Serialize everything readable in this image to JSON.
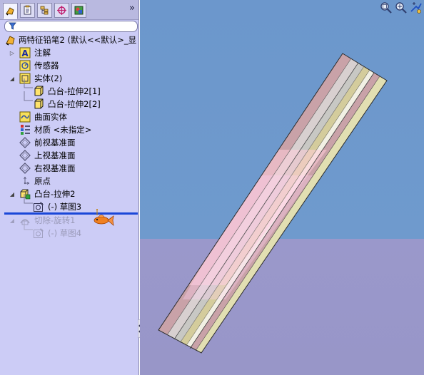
{
  "feature_manager": {
    "tabs": [
      {
        "name": "featuremanager-tab",
        "active": true
      },
      {
        "name": "propertymanager-tab",
        "active": false
      },
      {
        "name": "configurationmanager-tab",
        "active": false
      },
      {
        "name": "dimxpertmanager-tab",
        "active": false
      },
      {
        "name": "displaymanager-tab",
        "active": false
      }
    ],
    "overflow_label": "»",
    "filter_placeholder": "",
    "root_label": "两特征铅笔2 (默认<<默认>_显",
    "items": [
      {
        "label": "注解",
        "icon": "annotation-icon",
        "expander": "plus"
      },
      {
        "label": "传感器",
        "icon": "sensor-icon",
        "expander": ""
      },
      {
        "label": "实体(2)",
        "icon": "solid-bodies-folder-icon",
        "expander": "minus"
      },
      {
        "label": "凸台-拉伸2[1]",
        "icon": "solid-body-icon",
        "expander": ""
      },
      {
        "label": "凸台-拉伸2[2]",
        "icon": "solid-body-icon",
        "expander": ""
      },
      {
        "label": "曲面实体",
        "icon": "surface-bodies-folder-icon",
        "expander": ""
      },
      {
        "label": "材质 <未指定>",
        "icon": "material-icon",
        "expander": ""
      },
      {
        "label": "前视基准面",
        "icon": "plane-icon",
        "expander": ""
      },
      {
        "label": "上视基准面",
        "icon": "plane-icon",
        "expander": ""
      },
      {
        "label": "右视基准面",
        "icon": "plane-icon",
        "expander": ""
      },
      {
        "label": "原点",
        "icon": "origin-icon",
        "expander": ""
      },
      {
        "label": "凸台-拉伸2",
        "icon": "extrude-icon",
        "expander": "minus"
      },
      {
        "label": "(-) 草图3",
        "icon": "sketch-icon",
        "expander": ""
      },
      {
        "label": "切除-旋转1",
        "icon": "cut-revolve-icon",
        "expander": "minus",
        "suppressed": true
      },
      {
        "label": "(-) 草图4",
        "icon": "sketch-icon",
        "expander": "",
        "suppressed": true
      }
    ]
  },
  "graphics_area": {
    "toolbar": [
      "zoom-to-fit-icon",
      "zoom-to-area-icon",
      "previous-view-icon"
    ],
    "colors": {
      "sky": "#6f9acd",
      "ground": "#9a98cb",
      "pencil_body_pink": "#c9a2a8",
      "pencil_body_khaki": "#e2dfb2"
    }
  }
}
